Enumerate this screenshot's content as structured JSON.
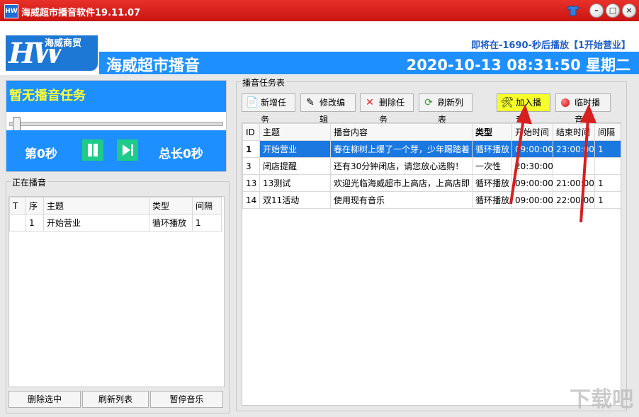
{
  "window": {
    "title": "海威超市播音软件19.11.07",
    "app_icon_text": "HW"
  },
  "header": {
    "logo_text": "HW",
    "logo_tag": "海威商贸",
    "app_name": "海威超市播音",
    "countdown": "即将在-1690-秒后播放【1开始营业】",
    "datetime": "2020-10-13 08:31:50 星期二"
  },
  "player": {
    "status": "暂无播音任务",
    "elapsed": "第0秒",
    "total": "总长0秒",
    "progress": 0
  },
  "now_playing": {
    "legend": "正在播音",
    "columns": [
      "T",
      "序",
      "主题",
      "类型",
      "间隔"
    ],
    "rows": [
      [
        "",
        "1",
        "开始营业",
        "循环播放",
        "1"
      ]
    ]
  },
  "left_buttons": {
    "delete_selected": "删除选中",
    "refresh": "刷新列表",
    "pause_music": "暂停音乐"
  },
  "task_table": {
    "legend": "播音任务表",
    "toolbar": {
      "add": "新增任务",
      "edit": "修改编辑",
      "delete": "删除任务",
      "refresh": "刷新列表",
      "join": "加入播音",
      "instant": "临时播音"
    },
    "columns": [
      "ID",
      "主题",
      "播音内容",
      "类型",
      "开始时间",
      "结束时间",
      "间隔"
    ],
    "rows": [
      [
        "1",
        "开始营业",
        "春在柳树上爆了一个芽，少年踢踏着",
        "循环播放",
        "09:00:00",
        "23:00:00",
        "1"
      ],
      [
        "3",
        "闭店提醒",
        "还有30分钟闭店，请您放心选购！",
        "一次性",
        "20:30:00",
        "",
        ""
      ],
      [
        "13",
        "13测试",
        "欢迎光临海威超市上高店，上高店即",
        "循环播放",
        "09:00:00",
        "21:00:00",
        "1"
      ],
      [
        "14",
        "双11活动",
        "使用现有音乐",
        "循环播放",
        "09:00:00",
        "22:00:00",
        "1"
      ]
    ]
  },
  "colors": {
    "titlebar": "#d11c17",
    "accent_blue": "#1e8fff",
    "status_yellow": "#ffff33",
    "highlight_button": "#f5ff2c",
    "selection": "#1a78e0",
    "arrow": "#d81e1e"
  },
  "watermark": "下载吧"
}
